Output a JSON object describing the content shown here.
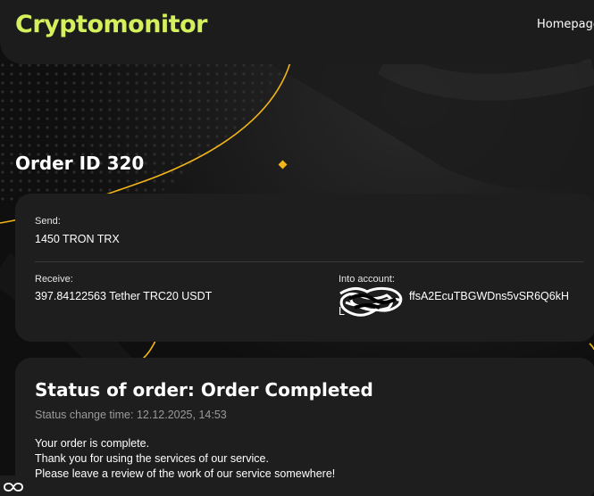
{
  "header": {
    "logo": "Cryptomonitor",
    "nav_home": "Homepage"
  },
  "page": {
    "title": "Order ID 320"
  },
  "order": {
    "send_label": "Send:",
    "send_value": "1450 TRON TRX",
    "receive_label": "Receive:",
    "receive_value": "397.84122563 Tether TRC20 USDT",
    "account_label": "Into account:",
    "account_value_line1": "ffsA2EcuTBGWDns5vSR6Q6kH",
    "account_value_line2": "L"
  },
  "status": {
    "title": "Status of order: Order Completed",
    "time": "Status change time: 12.12.2025, 14:53",
    "message_1": "Your order is complete.",
    "message_2": "Thank you for using the services of our service.",
    "message_3": "Please leave a review of the work of our service somewhere!"
  },
  "colors": {
    "accent": "#d4f05c",
    "decor_gold": "#f2b519",
    "card_bg": "#1e1e1e",
    "page_bg": "#0f0f0f"
  },
  "icons": {
    "floating_widget": "infinity-icon"
  }
}
